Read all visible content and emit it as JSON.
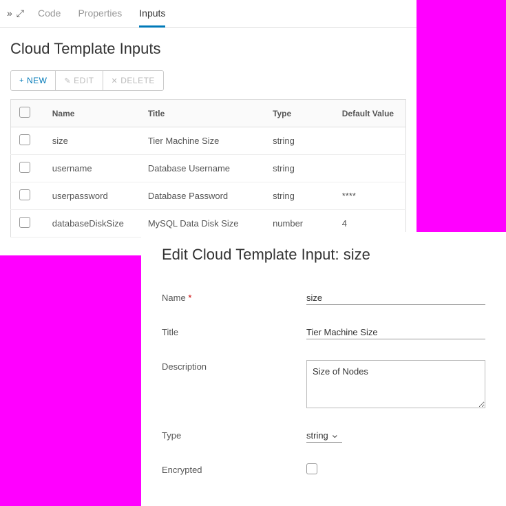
{
  "tabs": {
    "code": "Code",
    "properties": "Properties",
    "inputs": "Inputs"
  },
  "page_title": "Cloud Template Inputs",
  "actions": {
    "new": "NEW",
    "edit": "EDIT",
    "delete": "DELETE"
  },
  "table": {
    "headers": {
      "name": "Name",
      "title": "Title",
      "type": "Type",
      "default": "Default Value"
    },
    "rows": [
      {
        "name": "size",
        "title": "Tier Machine Size",
        "type": "string",
        "default": ""
      },
      {
        "name": "username",
        "title": "Database Username",
        "type": "string",
        "default": ""
      },
      {
        "name": "userpassword",
        "title": "Database Password",
        "type": "string",
        "default": "****"
      },
      {
        "name": "databaseDiskSize",
        "title": "MySQL Data Disk Size",
        "type": "number",
        "default": "4"
      }
    ]
  },
  "edit": {
    "heading_prefix": "Edit Cloud Template Input: ",
    "heading_value": "size",
    "labels": {
      "name": "Name",
      "title": "Title",
      "description": "Description",
      "type": "Type",
      "encrypted": "Encrypted"
    },
    "values": {
      "name": "size",
      "title": "Tier Machine Size",
      "description": "Size of Nodes",
      "type": "string"
    }
  }
}
